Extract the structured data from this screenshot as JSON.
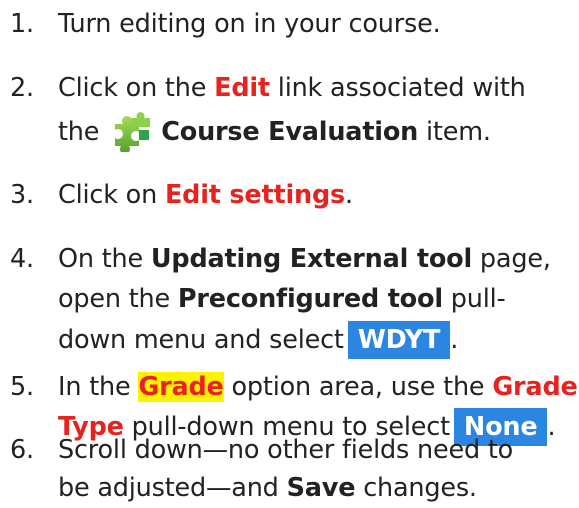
{
  "steps": [
    {
      "number": "1.",
      "line1": "Turn editing on in your course."
    },
    {
      "number": "2.",
      "line1_pre": "Click on the ",
      "line1_red": "Edit",
      "line1_post": " link associated with",
      "line2_pre": "the",
      "line2_bold": "Course Evaluation",
      "line2_post": " item.",
      "icon": "puzzle-piece-icon"
    },
    {
      "number": "3.",
      "line1_pre": "Click on ",
      "line1_red": "Edit settings",
      "line1_post": "."
    },
    {
      "number": "4.",
      "line1_pre": "On the ",
      "line1_bold": "Updating External tool",
      "line1_post": " page,",
      "line2_pre": "open the ",
      "line2_bold": "Preconfigured tool",
      "line2_post": " pull-",
      "line3_pre": "down menu and select",
      "line3_btn": "WDYT",
      "line3_post": "."
    },
    {
      "number": "5.",
      "line1_pre": "In the ",
      "line1_hl": "Grade",
      "line1_mid": " option area, use the ",
      "line1_red": "Grade",
      "line2_red": "Type",
      "line2_mid": " pull-down menu to select",
      "line2_btn": "None",
      "line2_post": "."
    },
    {
      "number": "6.",
      "line1": "Scroll down—no other fields need to",
      "line2_pre": "be adjusted—and ",
      "line2_bold": "Save",
      "line2_post": " changes."
    }
  ],
  "colors": {
    "text": "#222222",
    "red": "#e8231f",
    "highlight": "#fff200",
    "button": "#2a86e0",
    "icon_green": "#7ec242"
  }
}
